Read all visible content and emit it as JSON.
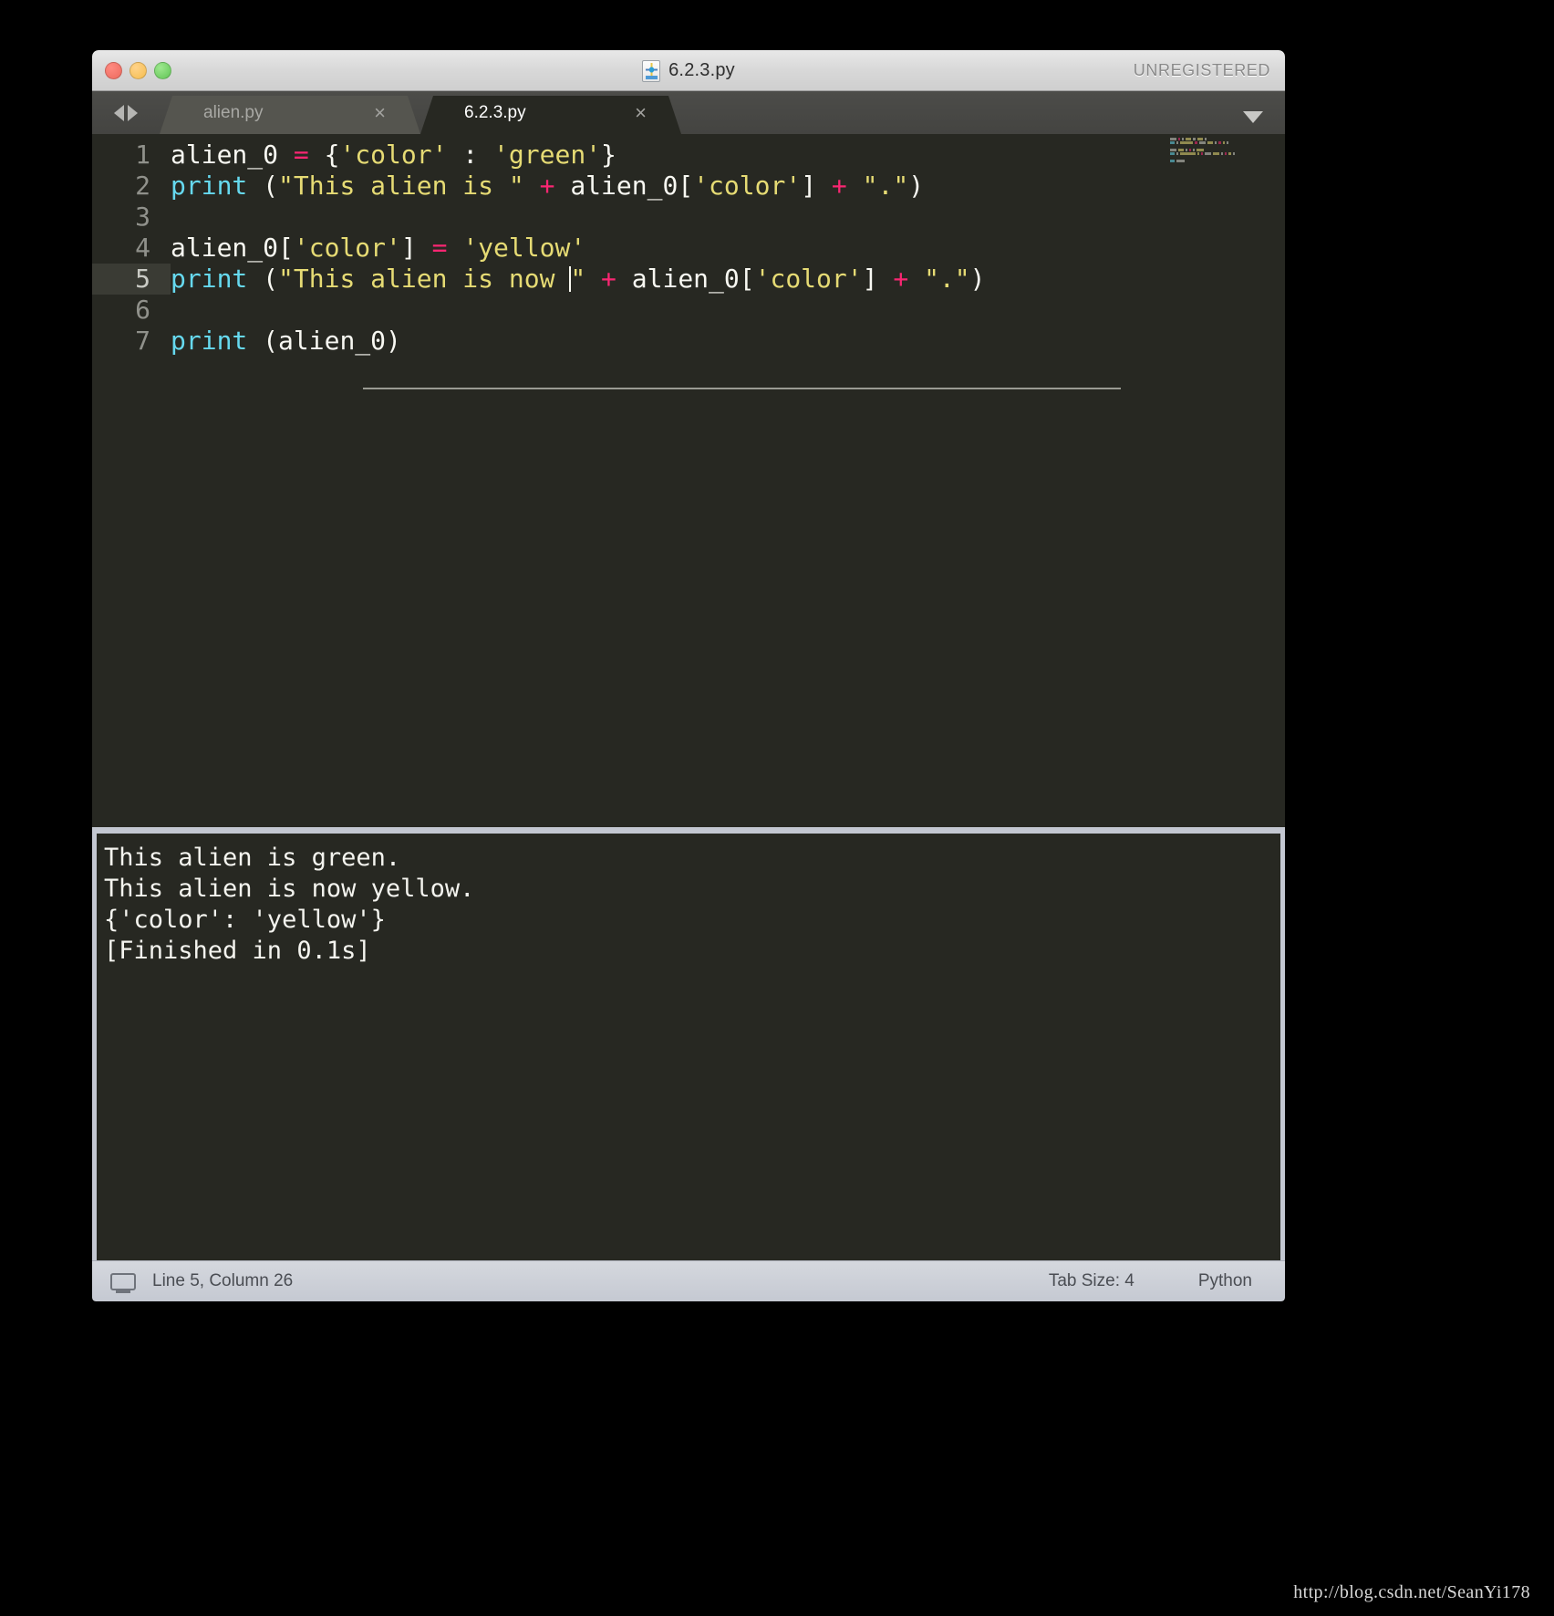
{
  "window": {
    "title": "6.2.3.py",
    "unregistered_label": "UNREGISTERED",
    "doc_icon": "sublime-text-file-icon",
    "traffic_lights": [
      {
        "name": "close",
        "color": "#ec6a5e"
      },
      {
        "name": "minimize",
        "color": "#f5bd4f"
      },
      {
        "name": "maximize",
        "color": "#61c555"
      }
    ]
  },
  "tabbar": {
    "nav_back_icon": "triangle-left-icon",
    "nav_forward_icon": "triangle-right-icon",
    "menu_icon": "chevron-down-icon",
    "close_glyph": "×",
    "tabs": [
      {
        "label": "alien.py",
        "active": false
      },
      {
        "label": "6.2.3.py",
        "active": true
      }
    ]
  },
  "editor": {
    "lines": [
      {
        "number": "1",
        "current": false,
        "tokens": [
          {
            "t": "alien_0 ",
            "c": "c-pln"
          },
          {
            "t": "=",
            "c": "c-op"
          },
          {
            "t": " {",
            "c": "c-pln"
          },
          {
            "t": "'color'",
            "c": "c-str"
          },
          {
            "t": " : ",
            "c": "c-pln"
          },
          {
            "t": "'green'",
            "c": "c-str"
          },
          {
            "t": "}",
            "c": "c-pln"
          }
        ]
      },
      {
        "number": "2",
        "current": false,
        "tokens": [
          {
            "t": "print",
            "c": "c-kw"
          },
          {
            "t": " (",
            "c": "c-pln"
          },
          {
            "t": "\"This alien is \"",
            "c": "c-str"
          },
          {
            "t": " + ",
            "c": "c-op"
          },
          {
            "t": "alien_0[",
            "c": "c-pln"
          },
          {
            "t": "'color'",
            "c": "c-str"
          },
          {
            "t": "]",
            "c": "c-pln"
          },
          {
            "t": " + ",
            "c": "c-op"
          },
          {
            "t": "\".\"",
            "c": "c-str"
          },
          {
            "t": ")",
            "c": "c-pln"
          }
        ]
      },
      {
        "number": "3",
        "current": false,
        "tokens": []
      },
      {
        "number": "4",
        "current": false,
        "tokens": [
          {
            "t": "alien_0[",
            "c": "c-pln"
          },
          {
            "t": "'color'",
            "c": "c-str"
          },
          {
            "t": "] ",
            "c": "c-pln"
          },
          {
            "t": "=",
            "c": "c-op"
          },
          {
            "t": " ",
            "c": "c-pln"
          },
          {
            "t": "'yellow'",
            "c": "c-str"
          }
        ]
      },
      {
        "number": "5",
        "current": true,
        "tokens": [
          {
            "t": "print",
            "c": "c-kw"
          },
          {
            "t": " (",
            "c": "c-pln"
          },
          {
            "t": "\"This alien is now ",
            "c": "c-str"
          },
          {
            "t": "CURSOR",
            "c": "cursor"
          },
          {
            "t": "\"",
            "c": "c-str"
          },
          {
            "t": " + ",
            "c": "c-op"
          },
          {
            "t": "alien_0[",
            "c": "c-pln"
          },
          {
            "t": "'color'",
            "c": "c-str"
          },
          {
            "t": "]",
            "c": "c-pln"
          },
          {
            "t": " + ",
            "c": "c-op"
          },
          {
            "t": "\".\"",
            "c": "c-str"
          },
          {
            "t": ")",
            "c": "c-pln"
          }
        ]
      },
      {
        "number": "6",
        "current": false,
        "tokens": []
      },
      {
        "number": "7",
        "current": false,
        "tokens": [
          {
            "t": "print",
            "c": "c-kw"
          },
          {
            "t": " (alien_0)",
            "c": "c-pln"
          }
        ]
      }
    ]
  },
  "console": {
    "output": "This alien is green.\nThis alien is now yellow.\n{'color': 'yellow'}\n[Finished in 0.1s]"
  },
  "statusbar": {
    "left_icon": "console-panel-icon",
    "position": "Line 5, Column 26",
    "tab_size": "Tab Size: 4",
    "language": "Python"
  },
  "watermark": "http://blog.csdn.net/SeanYi178",
  "colors": {
    "editor_bg": "#272822",
    "keyword": "#66d9ef",
    "operator": "#f92672",
    "string": "#e6db74",
    "plain": "#f8f8f2",
    "gutter": "#90918b",
    "current_line": "#3a3b34",
    "console_border": "#c3c7d1",
    "statusbar_text": "#4a4d53"
  }
}
